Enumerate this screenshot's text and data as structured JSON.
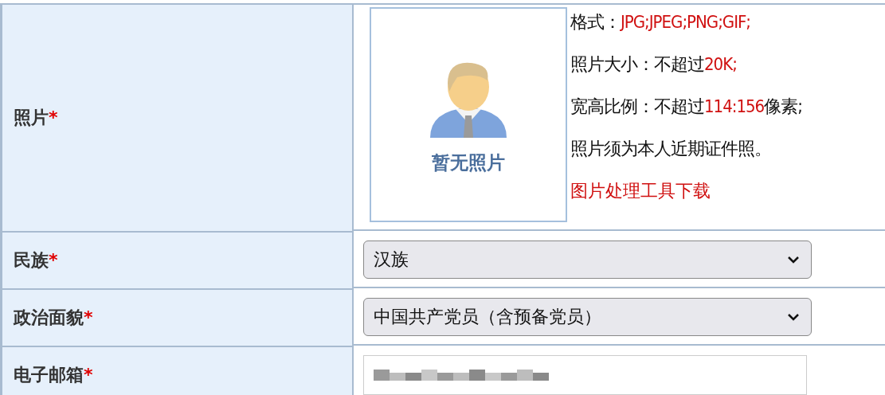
{
  "rows": [
    {
      "kind": "photo",
      "label": "照片",
      "required": "*",
      "photo": {
        "caption": "暂无照片"
      },
      "notes": [
        [
          {
            "text": "格式：",
            "emphasis": false
          },
          {
            "text": "JPG;JPEG;PNG;GIF;",
            "emphasis": true
          }
        ],
        [
          {
            "text": "照片大小：不超过",
            "emphasis": false
          },
          {
            "text": "20K;",
            "emphasis": true
          }
        ],
        [
          {
            "text": "宽高比例：不超过",
            "emphasis": false
          },
          {
            "text": "114:156",
            "emphasis": true
          },
          {
            "text": "像素;",
            "emphasis": false
          }
        ],
        [
          {
            "text": "照片须为本人近期证件照。",
            "emphasis": false
          }
        ]
      ],
      "link": "图片处理工具下载"
    },
    {
      "kind": "select",
      "label": "民族",
      "required": "*",
      "value": "汉族"
    },
    {
      "kind": "select",
      "label": "政治面貌",
      "required": "*",
      "value": "中国共产党员（含预备党员）"
    },
    {
      "kind": "input",
      "label": "电子邮箱",
      "required": "*",
      "obscured": true
    }
  ]
}
